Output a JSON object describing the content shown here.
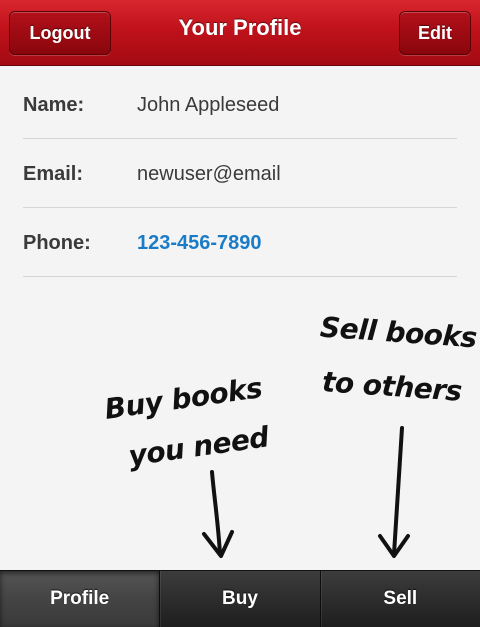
{
  "navbar": {
    "title": "Your Profile",
    "left_button": "Logout",
    "right_button": "Edit",
    "color": "#c0121b"
  },
  "profile": {
    "rows": [
      {
        "label": "Name:",
        "value": "John Appleseed"
      },
      {
        "label": "Email:",
        "value": "newuser@email"
      },
      {
        "label": "Phone:",
        "value": "123-456-7890"
      }
    ],
    "link_color": "#1a7cc7"
  },
  "annotations": {
    "buy_line1": "Buy books",
    "buy_line2": "you need",
    "sell_line1": "Sell books",
    "sell_line2": "to others"
  },
  "tabs": [
    {
      "label": "Profile",
      "active": true
    },
    {
      "label": "Buy",
      "active": false
    },
    {
      "label": "Sell",
      "active": false
    }
  ]
}
